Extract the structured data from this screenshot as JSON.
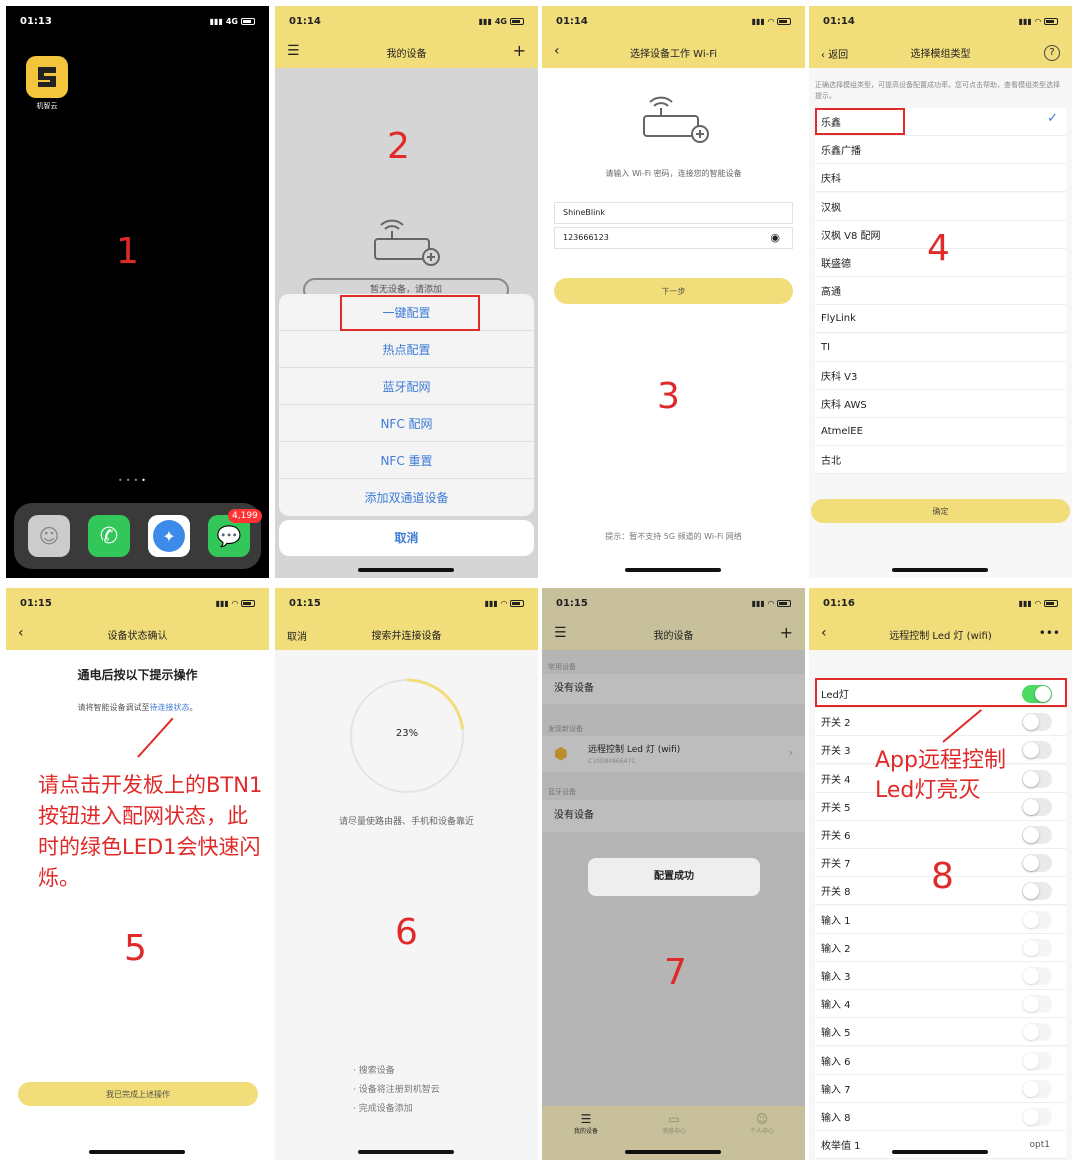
{
  "p1": {
    "time": "01:13",
    "net": "4G",
    "app_label": "机智云",
    "badge": "4,199",
    "num": "1"
  },
  "p2": {
    "time": "01:14",
    "net": "4G",
    "title": "我的设备",
    "empty": "暂无设备，请添加",
    "num": "2",
    "sheet": [
      "一键配置",
      "热点配置",
      "蓝牙配网",
      "NFC 配网",
      "NFC 重置",
      "添加双通道设备"
    ],
    "cancel": "取消"
  },
  "p3": {
    "time": "01:14",
    "title": "选择设备工作 Wi-Fi",
    "prompt": "请输入 Wi-Fi 密码，连接您的智能设备",
    "ssid": "ShineBlink",
    "password": "123666123",
    "next": "下一步",
    "num": "3",
    "tip": "提示：暂不支持 5G 频道的 Wi-Fi 网络"
  },
  "p4": {
    "time": "01:14",
    "back": "返回",
    "title": "选择模组类型",
    "desc": "正确选择模组类型，可提高设备配置成功率。您可点击帮助，查看模组类型选择提示。",
    "items": [
      "乐鑫",
      "乐鑫广播",
      "庆科",
      "汉枫",
      "汉枫 V8 配网",
      "联盛德",
      "高通",
      "FlyLink",
      "TI",
      "庆科 V3",
      "庆科 AWS",
      "AtmelEE",
      "古北"
    ],
    "confirm": "确定",
    "num": "4"
  },
  "p5": {
    "time": "01:15",
    "title": "设备状态确认",
    "heading": "通电后按以下提示操作",
    "hint_pre": "请将智能设备调试至",
    "hint_link": "待连接状态",
    "hint_post": "。",
    "note": "请点击开发板上的BTN1按钮进入配网状态，此时的绿色LED1会快速闪烁。",
    "done": "我已完成上述操作",
    "num": "5"
  },
  "p6": {
    "time": "01:15",
    "left": "取消",
    "title": "搜索并连接设备",
    "progress": "23%",
    "progress_value": 0.23,
    "hint": "请尽量使路由器、手机和设备靠近",
    "steps": [
      "· 搜索设备",
      "· 设备将注册到机智云",
      "· 完成设备添加"
    ],
    "num": "6"
  },
  "p7": {
    "time": "01:15",
    "title": "我的设备",
    "sec1": "常用设备",
    "none1": "没有设备",
    "sec2": "发现新设备",
    "device": "远程控制 Led 灯 (wifi)",
    "mac": "C10D84866A7C",
    "sec3": "蓝牙设备",
    "none2": "没有设备",
    "toast": "配置成功",
    "tabs": [
      "我的设备",
      "消息中心",
      "个人中心"
    ],
    "num": "7"
  },
  "p8": {
    "time": "01:16",
    "title": "远程控制 Led 灯 (wifi)",
    "rows": [
      "Led灯",
      "开关 2",
      "开关 3",
      "开关 4",
      "开关 5",
      "开关 6",
      "开关 7",
      "开关 8",
      "输入 1",
      "输入 2",
      "输入 3",
      "输入 4",
      "输入 5",
      "输入 6",
      "输入 7",
      "输入 8",
      "枚举值 1"
    ],
    "enum_value": "opt1",
    "note": "App远程控制Led灯亮灭",
    "num": "8"
  },
  "colors": {
    "yellow": "#f2dd7b",
    "red": "#e02a2a",
    "blue": "#3d7bd7",
    "green": "#4cd964"
  }
}
